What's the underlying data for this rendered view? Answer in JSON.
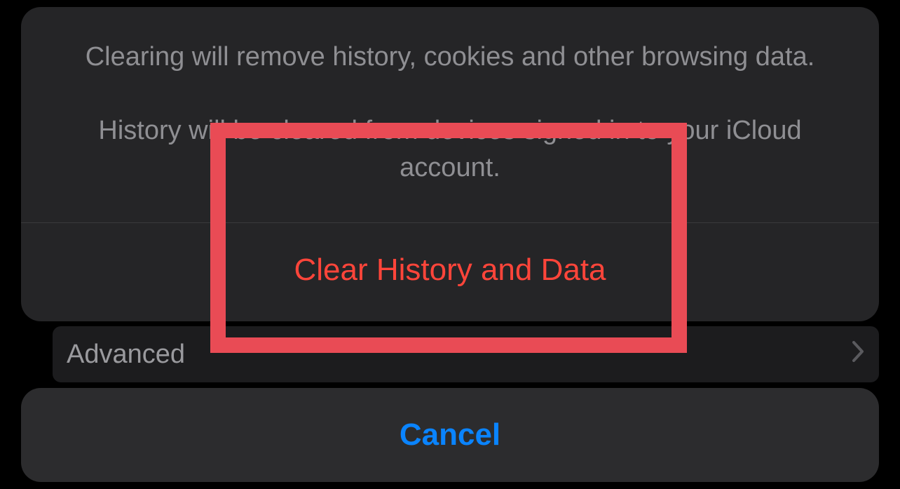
{
  "background": {
    "advanced_label": "Advanced"
  },
  "sheet": {
    "message_line1": "Clearing will remove history, cookies and other browsing data.",
    "message_line2": "History will be cleared from devices signed in to your iCloud account.",
    "destructive_label": "Clear History and Data",
    "cancel_label": "Cancel"
  }
}
